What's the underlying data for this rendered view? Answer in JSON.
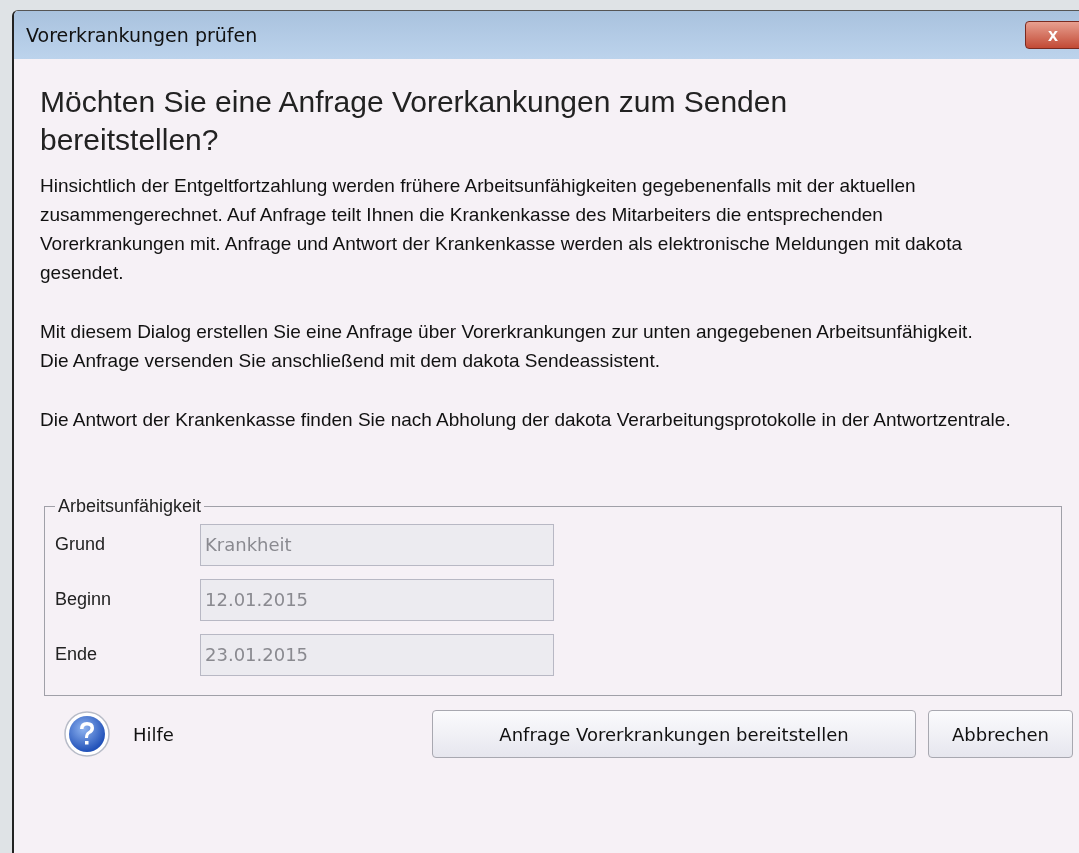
{
  "window": {
    "title": "Vorerkrankungen prüfen",
    "close": "x"
  },
  "heading": "Möchten Sie eine Anfrage Vorerkankungen zum Senden bereitstellen?",
  "sections": [
    [
      "Hinsichtlich der Entgeltfortzahlung werden frühere Arbeitsunfähigkeiten gegebenenfalls mit der aktuellen zusammengerechnet. Auf Anfrage teilt Ihnen die Krankenkasse des Mitarbeiters die entsprechenden Vorerkrankungen mit. Anfrage und Antwort der Krankenkasse werden als elektronische Meldungen mit dakota gesendet."
    ],
    [
      "Mit diesem Dialog erstellen Sie eine Anfrage über Vorerkrankungen zur unten angegebenen Arbeitsunfähigkeit.",
      "Die Anfrage versenden Sie anschließend mit dem dakota Sendeassistent."
    ],
    [
      "Die Antwort der Krankenkasse finden Sie nach Abholung der dakota Verarbeitungsprotokolle in der Antwortzentrale."
    ]
  ],
  "group": {
    "title": "Arbeitsunfähigkeit",
    "fields": [
      {
        "label": "Grund",
        "value": "Krankheit",
        "disabled": true
      },
      {
        "label": "Beginn",
        "value": "12.01.2015",
        "disabled": true
      },
      {
        "label": "Ende",
        "value": "23.01.2015",
        "disabled": true
      }
    ]
  },
  "help": {
    "label": "Hilfe"
  },
  "buttons": [
    "Anfrage Vorerkrankungen bereitstellen",
    "Abbrechen"
  ]
}
